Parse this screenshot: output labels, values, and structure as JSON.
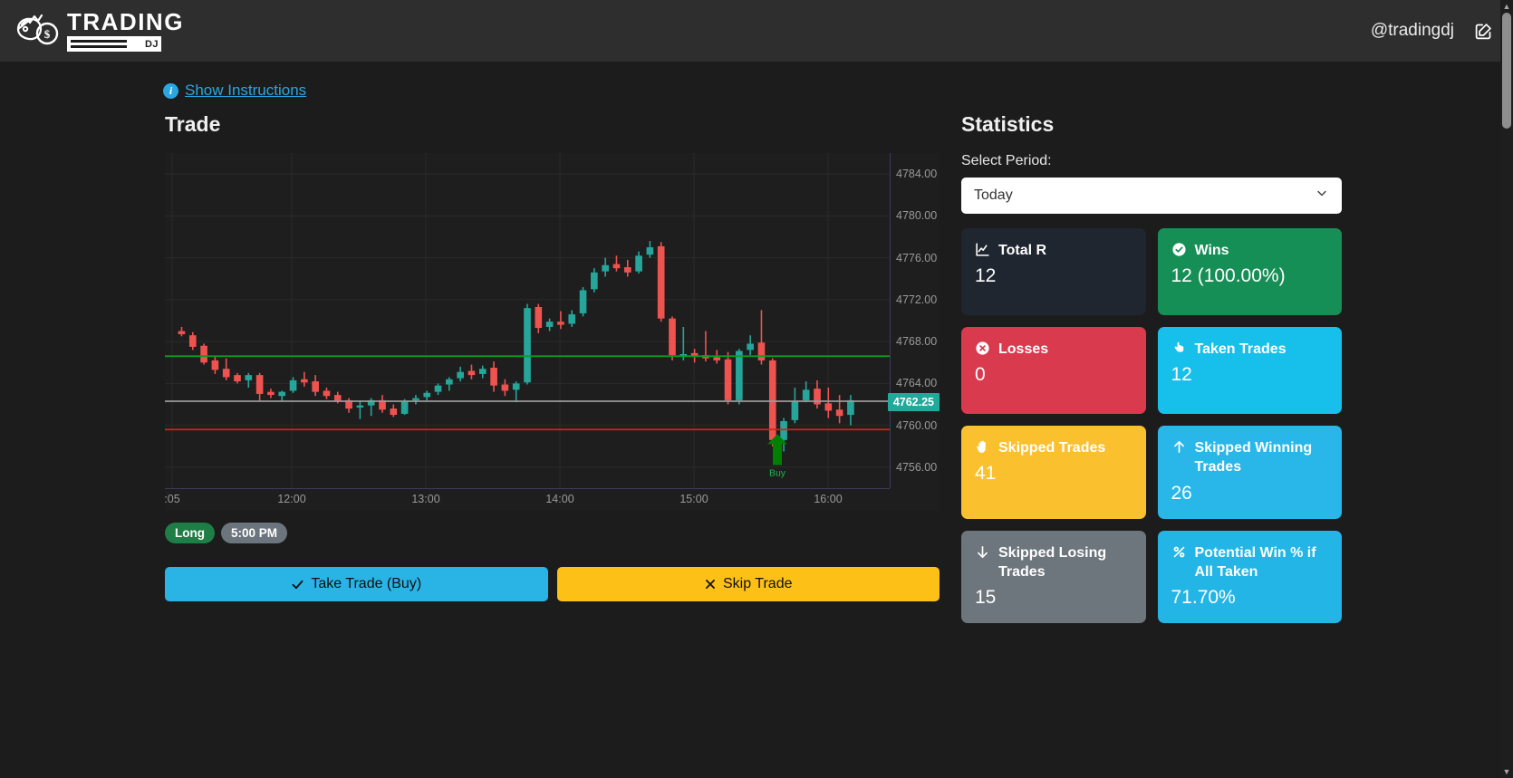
{
  "header": {
    "brand_name": "TRADING",
    "brand_sub": "DJ",
    "handle": "@tradingdj",
    "edit_icon": "edit-pencil-square-icon"
  },
  "instructions": {
    "icon": "info-circle-icon",
    "label": "Show Instructions"
  },
  "trade": {
    "title": "Trade",
    "badges": {
      "direction": "Long",
      "time": "5:00 PM"
    },
    "take_label": "Take Trade (Buy)",
    "skip_label": "Skip Trade",
    "take_icon": "check-icon",
    "skip_icon": "x-icon",
    "marker_label": "Buy"
  },
  "statistics": {
    "title": "Statistics",
    "period_label": "Select Period:",
    "period_value": "Today",
    "period_options": [
      "Today"
    ],
    "chevron_icon": "chevron-down-icon",
    "cards": [
      {
        "label": "Total R",
        "value": "12",
        "icon": "line-chart-icon",
        "color": "#1f2630",
        "cls": "c-dark"
      },
      {
        "label": "Wins",
        "value": "12 (100.00%)",
        "icon": "check-circle-icon",
        "color": "#168f56",
        "cls": "c-green"
      },
      {
        "label": "Losses",
        "value": "0",
        "icon": "x-circle-icon",
        "color": "#d93a4e",
        "cls": "c-red"
      },
      {
        "label": "Taken Trades",
        "value": "12",
        "icon": "pointing-hand-icon",
        "color": "#17c0ea",
        "cls": "c-cyan"
      },
      {
        "label": "Skipped Trades",
        "value": "41",
        "icon": "raised-hand-icon",
        "color": "#fbc02d",
        "cls": "c-yellow"
      },
      {
        "label": "Skipped Winning Trades",
        "value": "26",
        "icon": "arrow-up-icon",
        "color": "#29b6e8",
        "cls": "c-cyan2"
      },
      {
        "label": "Skipped Losing Trades",
        "value": "15",
        "icon": "arrow-down-icon",
        "color": "#6d757d",
        "cls": "c-gray"
      },
      {
        "label": "Potential Win % if All Taken",
        "value": "71.70%",
        "icon": "percent-icon",
        "color": "#23b5e6",
        "cls": "c-cyan3"
      }
    ]
  },
  "chart_data": {
    "type": "candlestick",
    "title": "",
    "xlabel": "",
    "ylabel": "",
    "ylim": [
      4754.0,
      4786.0
    ],
    "y_ticks": [
      "4784.00",
      "4780.00",
      "4776.00",
      "4772.00",
      "4768.00",
      "4764.00",
      "4760.00",
      "4756.00"
    ],
    "y_tick_values": [
      4784.0,
      4780.0,
      4776.0,
      4772.0,
      4768.0,
      4764.0,
      4760.0,
      4756.0
    ],
    "x_ticks": [
      ":05",
      "12:00",
      "13:00",
      "14:00",
      "15:00",
      "16:00"
    ],
    "x_tick_positions": [
      0.01,
      0.175,
      0.36,
      0.545,
      0.73,
      0.915
    ],
    "current_price_tag": "4762.25",
    "current_price": 4762.25,
    "grid": true,
    "legend": "none",
    "up_color": "#26a69a",
    "down_color": "#ef5350",
    "lines": [
      {
        "name": "take-profit-line",
        "price": 4766.6,
        "color": "#0a9e20"
      },
      {
        "name": "entry-line",
        "price": 4762.3,
        "color": "#9a9a9a"
      },
      {
        "name": "stop-loss-line",
        "price": 4759.6,
        "color": "#e01b1b"
      }
    ],
    "marker": {
      "name": "buy-arrow",
      "label": "Buy",
      "x": 0.845,
      "price": 4757.6,
      "color": "#008000"
    },
    "candles": [
      {
        "o": 4769.0,
        "h": 4769.4,
        "l": 4768.5,
        "c": 4768.7
      },
      {
        "o": 4768.6,
        "h": 4768.9,
        "l": 4767.2,
        "c": 4767.5
      },
      {
        "o": 4767.6,
        "h": 4767.8,
        "l": 4765.8,
        "c": 4766.0
      },
      {
        "o": 4766.2,
        "h": 4766.6,
        "l": 4764.9,
        "c": 4765.3
      },
      {
        "o": 4765.4,
        "h": 4766.4,
        "l": 4764.3,
        "c": 4764.6
      },
      {
        "o": 4764.8,
        "h": 4765.0,
        "l": 4764.0,
        "c": 4764.2
      },
      {
        "o": 4764.3,
        "h": 4765.0,
        "l": 4763.6,
        "c": 4764.8
      },
      {
        "o": 4764.8,
        "h": 4765.0,
        "l": 4762.3,
        "c": 4763.0
      },
      {
        "o": 4763.2,
        "h": 4763.5,
        "l": 4762.6,
        "c": 4762.9
      },
      {
        "o": 4762.8,
        "h": 4763.3,
        "l": 4762.3,
        "c": 4763.2
      },
      {
        "o": 4763.3,
        "h": 4764.6,
        "l": 4763.1,
        "c": 4764.3
      },
      {
        "o": 4764.4,
        "h": 4765.1,
        "l": 4763.7,
        "c": 4764.1
      },
      {
        "o": 4764.2,
        "h": 4764.8,
        "l": 4762.8,
        "c": 4763.2
      },
      {
        "o": 4763.3,
        "h": 4763.6,
        "l": 4762.5,
        "c": 4762.8
      },
      {
        "o": 4762.9,
        "h": 4763.2,
        "l": 4762.1,
        "c": 4762.3
      },
      {
        "o": 4762.4,
        "h": 4762.6,
        "l": 4761.2,
        "c": 4761.6
      },
      {
        "o": 4761.7,
        "h": 4762.4,
        "l": 4760.6,
        "c": 4761.9
      },
      {
        "o": 4761.9,
        "h": 4762.6,
        "l": 4760.9,
        "c": 4762.4
      },
      {
        "o": 4762.4,
        "h": 4762.9,
        "l": 4761.2,
        "c": 4761.5
      },
      {
        "o": 4761.6,
        "h": 4762.0,
        "l": 4760.8,
        "c": 4761.0
      },
      {
        "o": 4761.1,
        "h": 4762.5,
        "l": 4761.0,
        "c": 4762.3
      },
      {
        "o": 4762.4,
        "h": 4762.9,
        "l": 4762.0,
        "c": 4762.6
      },
      {
        "o": 4762.7,
        "h": 4763.3,
        "l": 4762.4,
        "c": 4763.1
      },
      {
        "o": 4763.2,
        "h": 4764.0,
        "l": 4762.9,
        "c": 4763.8
      },
      {
        "o": 4763.9,
        "h": 4764.6,
        "l": 4763.3,
        "c": 4764.4
      },
      {
        "o": 4764.5,
        "h": 4765.6,
        "l": 4764.2,
        "c": 4765.1
      },
      {
        "o": 4765.2,
        "h": 4765.8,
        "l": 4764.4,
        "c": 4764.8
      },
      {
        "o": 4764.9,
        "h": 4765.7,
        "l": 4764.5,
        "c": 4765.4
      },
      {
        "o": 4765.5,
        "h": 4766.1,
        "l": 4763.2,
        "c": 4763.8
      },
      {
        "o": 4763.9,
        "h": 4764.4,
        "l": 4762.8,
        "c": 4763.3
      },
      {
        "o": 4763.4,
        "h": 4764.2,
        "l": 4762.2,
        "c": 4764.0
      },
      {
        "o": 4764.1,
        "h": 4771.6,
        "l": 4763.9,
        "c": 4771.2
      },
      {
        "o": 4771.3,
        "h": 4771.6,
        "l": 4768.8,
        "c": 4769.3
      },
      {
        "o": 4769.4,
        "h": 4770.2,
        "l": 4769.0,
        "c": 4769.9
      },
      {
        "o": 4769.9,
        "h": 4770.9,
        "l": 4769.2,
        "c": 4769.6
      },
      {
        "o": 4769.7,
        "h": 4771.0,
        "l": 4769.4,
        "c": 4770.6
      },
      {
        "o": 4770.7,
        "h": 4773.2,
        "l": 4770.4,
        "c": 4772.9
      },
      {
        "o": 4773.0,
        "h": 4775.0,
        "l": 4772.7,
        "c": 4774.6
      },
      {
        "o": 4774.7,
        "h": 4776.0,
        "l": 4774.2,
        "c": 4775.3
      },
      {
        "o": 4775.4,
        "h": 4776.2,
        "l": 4774.7,
        "c": 4775.0
      },
      {
        "o": 4775.1,
        "h": 4775.8,
        "l": 4774.2,
        "c": 4774.6
      },
      {
        "o": 4774.7,
        "h": 4776.6,
        "l": 4774.5,
        "c": 4776.2
      },
      {
        "o": 4776.3,
        "h": 4777.6,
        "l": 4776.0,
        "c": 4777.0
      },
      {
        "o": 4777.1,
        "h": 4777.5,
        "l": 4769.9,
        "c": 4770.2
      },
      {
        "o": 4770.2,
        "h": 4770.4,
        "l": 4766.2,
        "c": 4766.7
      },
      {
        "o": 4766.8,
        "h": 4769.4,
        "l": 4766.2,
        "c": 4766.8
      },
      {
        "o": 4766.9,
        "h": 4767.3,
        "l": 4766.0,
        "c": 4766.6
      },
      {
        "o": 4766.7,
        "h": 4769.0,
        "l": 4766.1,
        "c": 4766.4
      },
      {
        "o": 4766.5,
        "h": 4767.2,
        "l": 4765.9,
        "c": 4766.2
      },
      {
        "o": 4766.3,
        "h": 4767.0,
        "l": 4762.0,
        "c": 4762.4
      },
      {
        "o": 4762.4,
        "h": 4767.3,
        "l": 4762.0,
        "c": 4767.1
      },
      {
        "o": 4767.2,
        "h": 4768.6,
        "l": 4766.7,
        "c": 4767.8
      },
      {
        "o": 4767.9,
        "h": 4771.0,
        "l": 4765.8,
        "c": 4766.2
      },
      {
        "o": 4766.2,
        "h": 4766.4,
        "l": 4758.0,
        "c": 4758.6
      },
      {
        "o": 4758.6,
        "h": 4760.7,
        "l": 4757.5,
        "c": 4760.4
      },
      {
        "o": 4760.5,
        "h": 4763.6,
        "l": 4760.2,
        "c": 4762.3
      },
      {
        "o": 4762.4,
        "h": 4764.2,
        "l": 4762.2,
        "c": 4763.4
      },
      {
        "o": 4763.5,
        "h": 4764.3,
        "l": 4761.6,
        "c": 4762.0
      },
      {
        "o": 4762.1,
        "h": 4763.6,
        "l": 4760.7,
        "c": 4761.4
      },
      {
        "o": 4761.5,
        "h": 4762.9,
        "l": 4760.2,
        "c": 4760.9
      },
      {
        "o": 4761.0,
        "h": 4762.9,
        "l": 4760.0,
        "c": 4762.4
      }
    ]
  }
}
